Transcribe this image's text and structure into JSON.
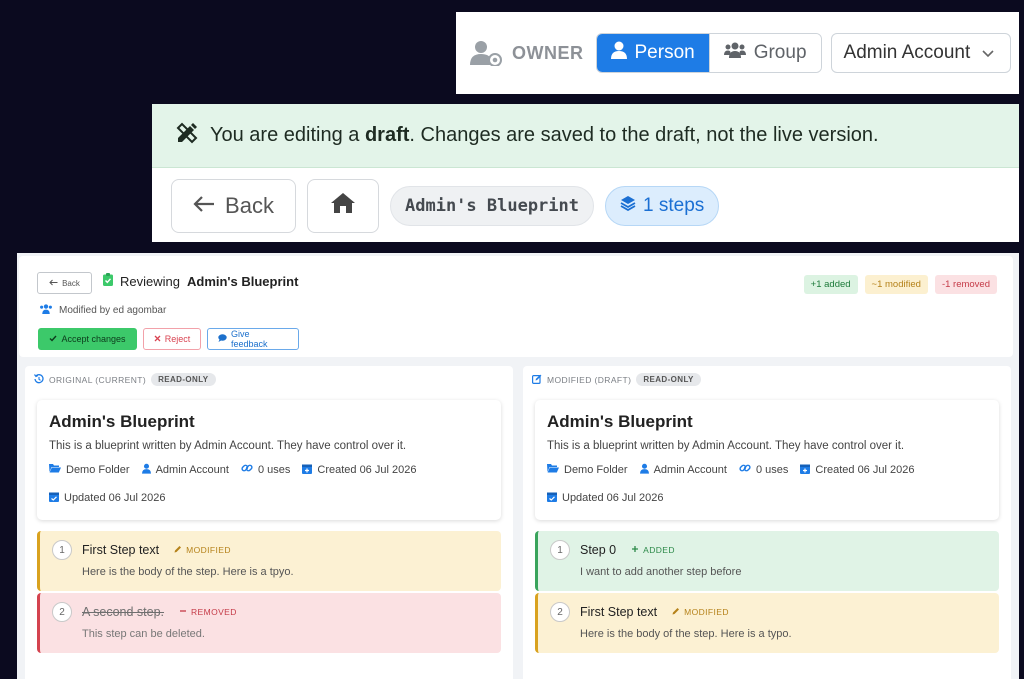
{
  "owner": {
    "label": "OWNER",
    "person_label": "Person",
    "group_label": "Group",
    "account_select": "Admin Account"
  },
  "draft": {
    "prefix": "You are editing a",
    "bold": "draft",
    "suffix": ". Changes are saved to the draft, not the live version."
  },
  "nav": {
    "back_label": "Back",
    "blueprint_name": "Admin's Blueprint",
    "steps_label": "1 steps"
  },
  "review": {
    "back_label": "Back",
    "reviewing_prefix": "Reviewing",
    "blueprint_name": "Admin's Blueprint",
    "modified_by": "Modified by ed agombar",
    "accept_label": "Accept changes",
    "reject_label": "Reject",
    "feedback_label": "Give feedback",
    "badges": {
      "added": "+1 added",
      "modified": "~1 modified",
      "removed": "-1 removed"
    }
  },
  "original": {
    "header": "ORIGINAL (CURRENT)",
    "readonly": "READ-ONLY",
    "card": {
      "title": "Admin's Blueprint",
      "description": "This is a blueprint written by Admin Account. They have control over it.",
      "folder": "Demo Folder",
      "owner": "Admin Account",
      "uses": "0 uses",
      "created": "Created 06 Jul 2026",
      "updated": "Updated 06 Jul 2026"
    },
    "steps": [
      {
        "num": "1",
        "title": "First Step text",
        "tag": "MODIFIED",
        "body": "Here is the body of the step. Here is a tpyo."
      },
      {
        "num": "2",
        "title": "A second step.",
        "tag": "REMOVED",
        "body": "This step can be deleted."
      }
    ]
  },
  "modified": {
    "header": "MODIFIED (DRAFT)",
    "readonly": "READ-ONLY",
    "card": {
      "title": "Admin's Blueprint",
      "description": "This is a blueprint written by Admin Account. They have control over it.",
      "folder": "Demo Folder",
      "owner": "Admin Account",
      "uses": "0 uses",
      "created": "Created 06 Jul 2026",
      "updated": "Updated 06 Jul 2026"
    },
    "steps": [
      {
        "num": "1",
        "title": "Step 0",
        "tag": "ADDED",
        "body": "I want to add another step before"
      },
      {
        "num": "2",
        "title": "First Step text",
        "tag": "MODIFIED",
        "body": "Here is the body of the step. Here is a typo."
      }
    ]
  },
  "colors": {
    "primary": "#1e7ce6",
    "draft_banner": "#e3f4e9",
    "added": "#3aa45c",
    "modified": "#d9a21f",
    "removed": "#d4434f"
  }
}
